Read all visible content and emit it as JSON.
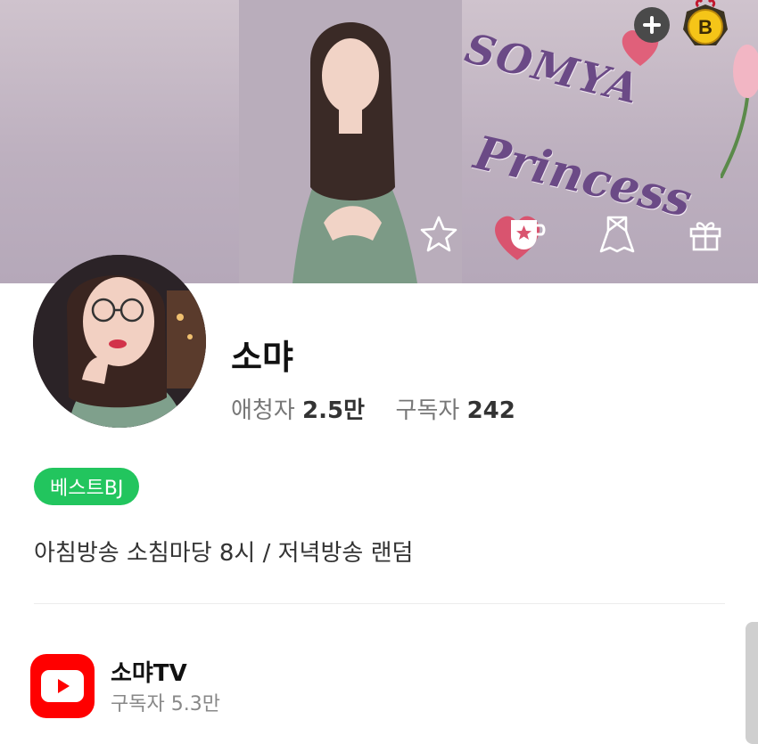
{
  "banner": {
    "text_line1": "SOMYA",
    "text_line2": "Princess"
  },
  "header_actions": {
    "add_icon": "plus-icon",
    "badge_letter": "B"
  },
  "banner_icons": [
    "star-icon",
    "cup-star-icon",
    "ribbon-icon",
    "gift-icon"
  ],
  "profile": {
    "name": "소먀",
    "fans_label": "애청자",
    "fans_value": "2.5만",
    "subs_label": "구독자",
    "subs_value": "242",
    "badge": "베스트BJ",
    "description": "아침방송 소침마당 8시 / 저녁방송 랜덤"
  },
  "youtube": {
    "channel_name": "소먀TV",
    "subscribers": "구독자 5.3만"
  },
  "colors": {
    "badge_green": "#22c55e",
    "youtube_red": "#ff0000"
  }
}
